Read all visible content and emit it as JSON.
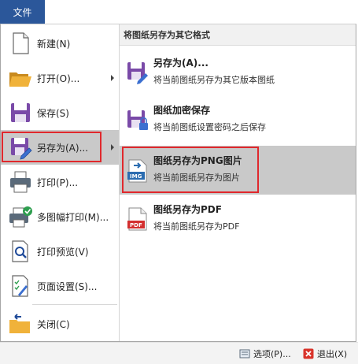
{
  "ribbon": {
    "file_tab": "文件"
  },
  "left_menu": {
    "items": [
      {
        "label": "新建(N)",
        "icon": "new-document-icon"
      },
      {
        "label": "打开(O)...",
        "icon": "open-folder-icon",
        "has_submenu": true
      },
      {
        "label": "保存(S)",
        "icon": "save-disk-icon"
      },
      {
        "label": "另存为(A)...",
        "icon": "save-as-icon",
        "has_submenu": true,
        "selected": true
      },
      {
        "label": "打印(P)...",
        "icon": "printer-icon"
      },
      {
        "label": "多图幅打印(M)...",
        "icon": "batch-print-icon"
      },
      {
        "label": "打印预览(V)",
        "icon": "print-preview-icon"
      },
      {
        "label": "页面设置(S)...",
        "icon": "page-setup-icon"
      },
      {
        "label": "关闭(C)",
        "icon": "close-folder-icon"
      }
    ]
  },
  "submenu": {
    "header": "将图纸另存为其它格式",
    "items": [
      {
        "title": "另存为(A)...",
        "desc": "将当前图纸另存为其它版本图纸",
        "icon": "save-as-icon"
      },
      {
        "title": "图纸加密保存",
        "desc": "将当前图纸设置密码之后保存",
        "icon": "encrypt-save-icon"
      },
      {
        "title": "图纸另存为PNG图片",
        "desc": "将当前图纸另存为图片",
        "icon": "png-image-icon",
        "selected": true
      },
      {
        "title": "图纸另存为PDF",
        "desc": "将当前图纸另存为PDF",
        "icon": "pdf-file-icon"
      }
    ]
  },
  "footer": {
    "options_label": "选项(P)...",
    "exit_label": "退出(X)"
  },
  "colors": {
    "file_tab": "#2b579a",
    "selection": "#c9c9c9",
    "highlight_border": "#e0282c",
    "disk_purple": "#7a4aa8",
    "folder_yellow": "#f0b23a",
    "pdf_red": "#d32f2f",
    "img_blue": "#2b6cb0"
  }
}
